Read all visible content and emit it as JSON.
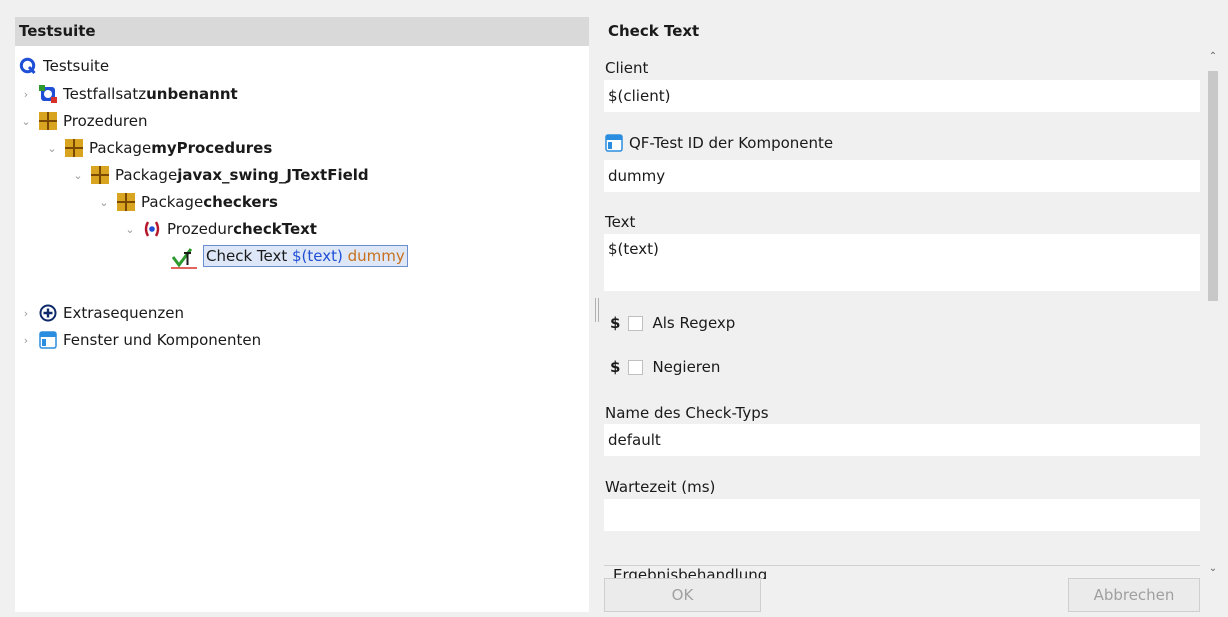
{
  "left_pane": {
    "header": "Testsuite",
    "tree": [
      {
        "prefix": "Testsuite",
        "name": "",
        "expanded": null
      },
      {
        "prefix": "Testfallsatz ",
        "name": "unbenannt",
        "expanded": false
      },
      {
        "prefix": "Prozeduren",
        "name": "",
        "expanded": true
      },
      {
        "prefix": "Package ",
        "name": "myProcedures",
        "expanded": true
      },
      {
        "prefix": "Package ",
        "name": "javax_swing_JTextField",
        "expanded": true
      },
      {
        "prefix": "Package ",
        "name": "checkers",
        "expanded": true
      },
      {
        "prefix": "Prozedur ",
        "name": "checkText",
        "expanded": true
      },
      {
        "prefix": "Check Text ",
        "var1": "$(text)",
        "var2": "dummy",
        "selected": true
      },
      {
        "prefix": "Extrasequenzen",
        "name": "",
        "expanded": false
      },
      {
        "prefix": "Fenster und Komponenten",
        "name": "",
        "expanded": false
      }
    ]
  },
  "right_pane": {
    "title": "Check Text",
    "client": {
      "label": "Client",
      "value": "$(client)"
    },
    "component": {
      "label": "QF-Test ID der Komponente",
      "value": "dummy"
    },
    "text": {
      "label": "Text",
      "value": "$(text)"
    },
    "regexp": {
      "symbol": "$",
      "label": "Als Regexp",
      "checked": false
    },
    "negate": {
      "symbol": "$",
      "label": "Negieren",
      "checked": false
    },
    "check_type": {
      "label": "Name des Check-Typs",
      "value": "default"
    },
    "wait_time": {
      "label": "Wartezeit (ms)",
      "value": ""
    },
    "result_group": "Ergebnisbehandlung",
    "ok_label": "OK",
    "cancel_label": "Abbrechen"
  },
  "colors": {
    "accent_blue": "#1f4fd6",
    "package_gold": "#d9a520",
    "procedure_red": "#b5162b",
    "check_green": "#2e9a2e"
  }
}
